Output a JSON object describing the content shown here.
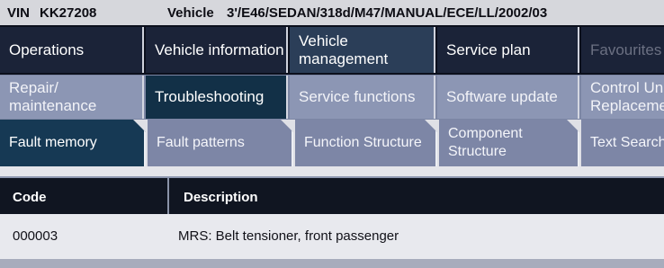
{
  "header": {
    "vin_label": "VIN",
    "vin_value": "KK27208",
    "vehicle_label": "Vehicle",
    "vehicle_value": "3'/E46/SEDAN/318d/M47/MANUAL/ECE/LL/2002/03"
  },
  "main_tabs": [
    {
      "label": "Operations"
    },
    {
      "label": "Vehicle information"
    },
    {
      "label": "Vehicle management"
    },
    {
      "label": "Service plan"
    },
    {
      "label": "Favourites"
    }
  ],
  "sub_tabs": [
    {
      "label": "Repair/ maintenance"
    },
    {
      "label": "Troubleshooting"
    },
    {
      "label": "Service functions"
    },
    {
      "label": "Software update"
    },
    {
      "label": "Control Unit Replacement"
    }
  ],
  "section_tabs": [
    {
      "label": "Fault memory"
    },
    {
      "label": "Fault patterns"
    },
    {
      "label": "Function Structure"
    },
    {
      "label": "Component Structure"
    },
    {
      "label": "Text Search"
    }
  ],
  "table": {
    "columns": [
      "Code",
      "Description"
    ],
    "rows": [
      {
        "code": "000003",
        "description": "MRS: Belt tensioner, front passenger"
      }
    ]
  }
}
